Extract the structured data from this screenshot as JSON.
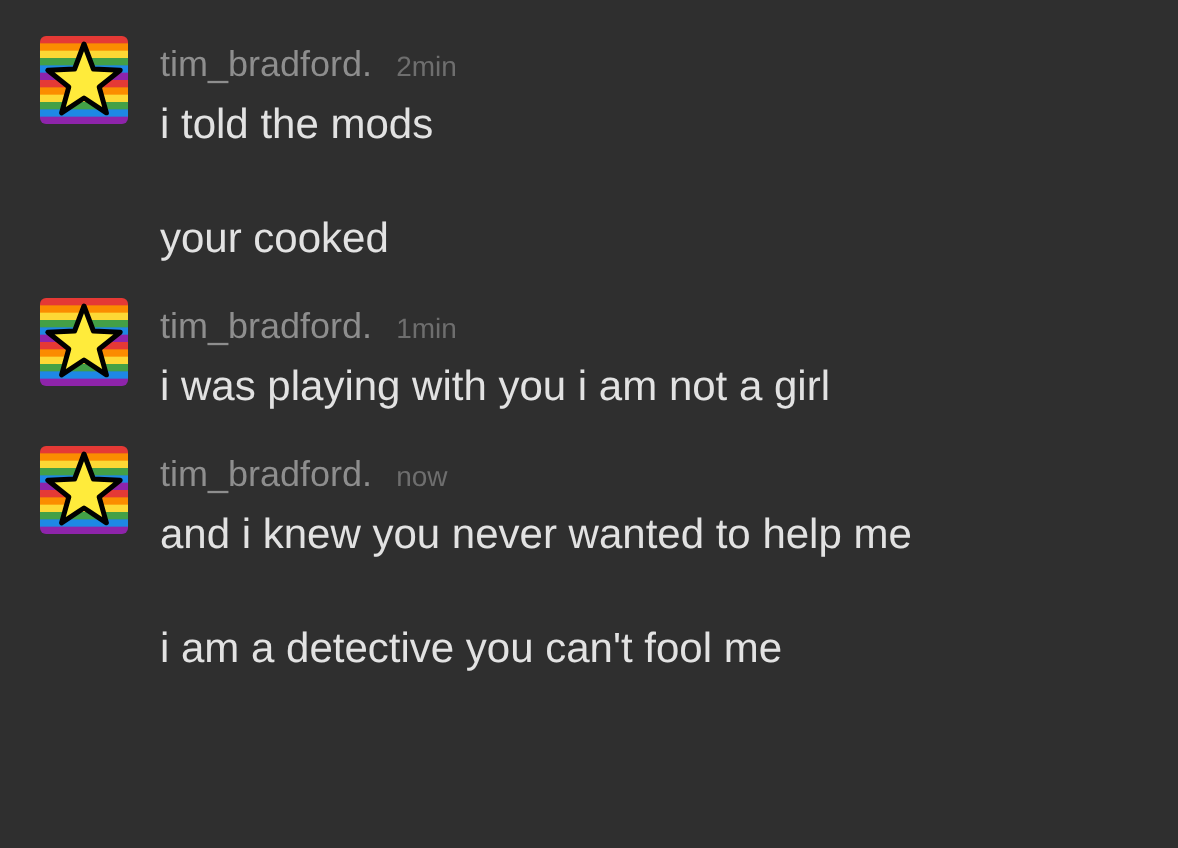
{
  "messages": [
    {
      "author": "tim_bradford.",
      "time": "2min",
      "lines": [
        "i told the mods",
        "your cooked"
      ]
    },
    {
      "author": "tim_bradford.",
      "time": "1min",
      "lines": [
        "i was playing with you i am not a girl"
      ]
    },
    {
      "author": "tim_bradford.",
      "time": "now",
      "lines": [
        "and i knew you never wanted to help me",
        "i am a detective you can't fool me"
      ]
    }
  ]
}
